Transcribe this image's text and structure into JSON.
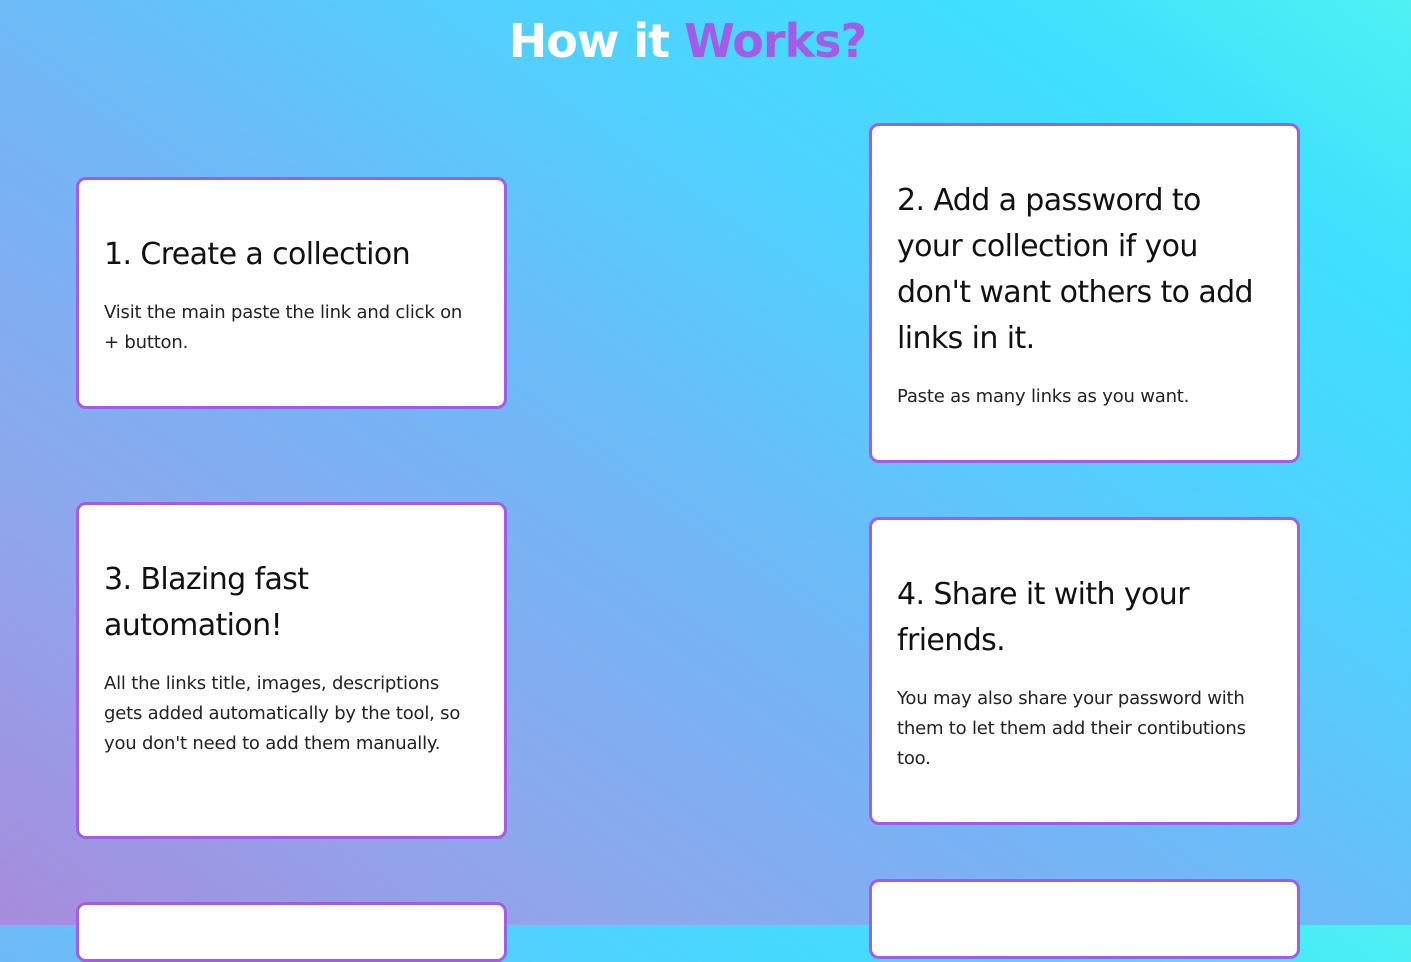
{
  "heading": {
    "part1": "How it",
    "part2": "Works?"
  },
  "colors": {
    "accent": "#a05ee6",
    "card_background": "#ffffff",
    "heading_white": "#ffffff"
  },
  "steps": [
    {
      "title": "1. Create a collection",
      "text": "Visit the main paste the link and click on + button."
    },
    {
      "title": "2. Add a password to your collection if you don't want others to add links in it.",
      "text": "Paste as many links as you want."
    },
    {
      "title": "3. Blazing fast automation!",
      "text": "All the links title, images, descriptions gets added automatically by the tool, so you don't need to add them manually."
    },
    {
      "title": "4. Share it with your friends.",
      "text": "You may also share your password with them to let them add their contibutions too."
    }
  ]
}
